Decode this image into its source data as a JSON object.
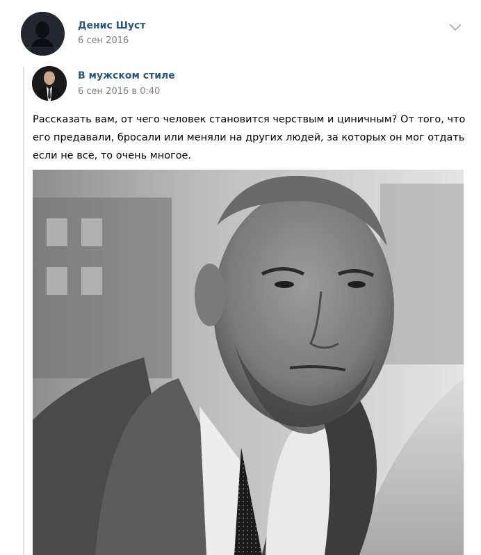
{
  "post": {
    "author_name": "Денис Шуст",
    "date": "6 сен 2016",
    "menu_icon": "chevron-down-icon"
  },
  "repost": {
    "source_name": "В мужском стиле",
    "source_date": "6 сен 2016 в 0:40",
    "text": "Рассказать вам, от чего человек становится черствым и циничным? От того, что его предавали, бросали или меняли на других людей, за которых он мог отдать если не все, то очень многое."
  },
  "colors": {
    "link": "#2a5885",
    "meta": "#828282",
    "repost_bar": "#dfe3e8"
  }
}
